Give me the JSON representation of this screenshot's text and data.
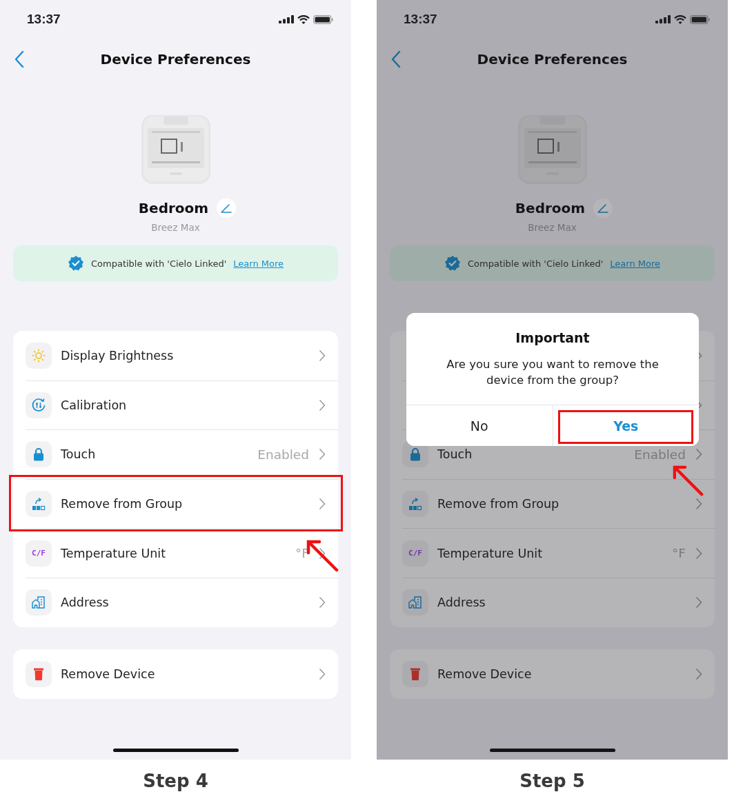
{
  "steps": [
    {
      "caption": "Step 4",
      "status_bar": {
        "time": "13:37"
      },
      "nav": {
        "title": "Device Preferences"
      },
      "device": {
        "name": "Bedroom",
        "model": "Breez Max"
      },
      "banner": {
        "text": "Compatible with 'Cielo Linked'",
        "link": "Learn More"
      },
      "settings": [
        {
          "kind": "brightness",
          "label": "Display Brightness",
          "highlighted": false
        },
        {
          "kind": "calibration",
          "label": "Calibration",
          "highlighted": false
        },
        {
          "kind": "touch",
          "label": "Touch",
          "value": "Enabled",
          "highlighted": false
        },
        {
          "kind": "group",
          "label": "Remove from Group",
          "highlighted": true
        },
        {
          "kind": "unit",
          "icon_text": "C/F",
          "label": "Temperature Unit",
          "value": "°F",
          "highlighted": false
        },
        {
          "kind": "address",
          "label": "Address",
          "highlighted": false
        }
      ],
      "remove": {
        "label": "Remove Device"
      },
      "dimmed": false
    },
    {
      "caption": "Step 5",
      "status_bar": {
        "time": "13:37"
      },
      "nav": {
        "title": "Device Preferences"
      },
      "device": {
        "name": "Bedroom",
        "model": "Breez Max"
      },
      "banner": {
        "text": "Compatible with 'Cielo Linked'",
        "link": "Learn More"
      },
      "settings": [
        {
          "kind": "covered"
        },
        {
          "kind": "covered"
        },
        {
          "kind": "touch",
          "label": "Touch",
          "value": "Enabled",
          "highlighted": false
        },
        {
          "kind": "group",
          "label": "Remove from Group",
          "highlighted": false
        },
        {
          "kind": "unit",
          "icon_text": "C/F",
          "label": "Temperature Unit",
          "value": "°F",
          "highlighted": false
        },
        {
          "kind": "address",
          "label": "Address",
          "highlighted": false
        }
      ],
      "remove": {
        "label": "Remove Device"
      },
      "dimmed": true,
      "dialog": {
        "title": "Important",
        "message": "Are you sure you want to remove the device from the group?",
        "buttons": [
          {
            "label": "No",
            "kind": "cancel",
            "highlighted": false
          },
          {
            "label": "Yes",
            "kind": "confirm",
            "highlighted": true
          }
        ]
      }
    }
  ]
}
